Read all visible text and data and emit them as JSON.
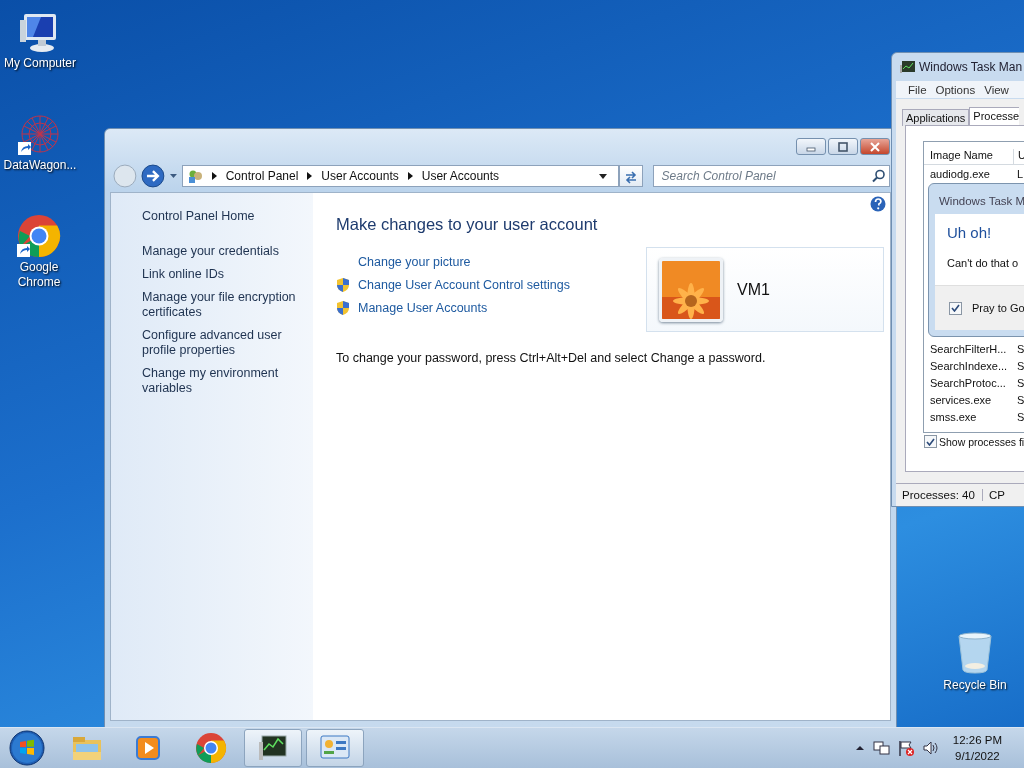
{
  "desktop_icons": [
    {
      "label": "My Computer",
      "kind": "computer"
    },
    {
      "label": "DataWagon...",
      "kind": "datawagon"
    },
    {
      "label": "Google Chrome",
      "kind": "chrome"
    },
    {
      "label": "Recycle Bin",
      "kind": "recycle"
    }
  ],
  "control_panel": {
    "breadcrumb": [
      "Control Panel",
      "User Accounts",
      "User Accounts"
    ],
    "search": {
      "placeholder": "Search Control Panel"
    },
    "sidebar": {
      "home": "Control Panel Home",
      "tasks": [
        "Manage your credentials",
        "Link online IDs",
        "Manage your file encryption certificates",
        "Configure advanced user profile properties",
        "Change my environment variables"
      ]
    },
    "heading": "Make changes to your user account",
    "links": [
      {
        "label": "Change your picture",
        "kind": "plain"
      },
      {
        "label": "Change User Account Control settings",
        "kind": "shield"
      },
      {
        "label": "Manage User Accounts",
        "kind": "shield"
      }
    ],
    "account": {
      "name": "VM1"
    },
    "note": "To change your password, press Ctrl+Alt+Del and select Change a password."
  },
  "task_manager": {
    "title": "Windows Task Man",
    "menu": [
      "File",
      "Options",
      "View"
    ],
    "tabs": [
      {
        "label": "Applications",
        "selected": false
      },
      {
        "label": "Processe",
        "selected": true
      }
    ],
    "columns": [
      "Image Name",
      "U"
    ],
    "rows_top": [
      {
        "name": "audiodg.exe",
        "user": "L"
      }
    ],
    "rows_bottom": [
      {
        "name": "SearchFilterH...",
        "user": "S"
      },
      {
        "name": "SearchIndexe...",
        "user": "S"
      },
      {
        "name": "SearchProtoc...",
        "user": "S"
      },
      {
        "name": "services.exe",
        "user": "S"
      },
      {
        "name": "smss.exe",
        "user": "S"
      }
    ],
    "show_all": {
      "label": "Show processes fi",
      "checked": true
    },
    "status": [
      "Processes: 40",
      "CP"
    ],
    "dialog": {
      "title": "Windows Task M",
      "heading": "Uh oh!",
      "message": "Can't do that o",
      "checkbox": {
        "label": "Pray to Go",
        "checked": true
      }
    }
  },
  "taskbar": {
    "buttons": [
      {
        "kind": "explorer",
        "running": false
      },
      {
        "kind": "media",
        "running": false
      },
      {
        "kind": "chrome",
        "running": false
      },
      {
        "kind": "taskmgr",
        "running": true
      },
      {
        "kind": "control",
        "running": true
      }
    ],
    "clock": {
      "time": "12:26 PM",
      "date": "9/1/2022"
    }
  }
}
